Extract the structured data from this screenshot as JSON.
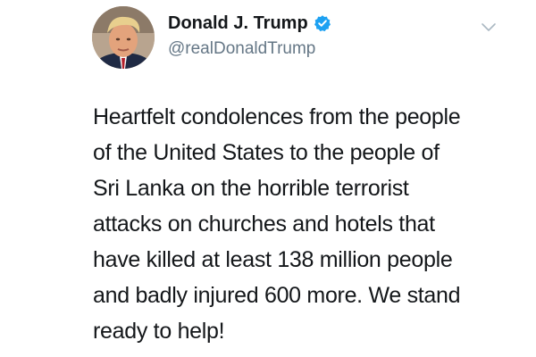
{
  "tweet": {
    "author": {
      "display_name": "Donald J. Trump",
      "handle": "@realDonaldTrump",
      "verified": true,
      "avatar_icon": "profile-photo"
    },
    "menu_icon": "chevron-down-icon",
    "text_lines": [
      "Heartfelt condolences from the people",
      "of the United States to the people of",
      "Sri Lanka on the horrible terrorist",
      "attacks on churches and hotels that",
      "have killed at least 138 million people",
      "and badly injured 600 more. We stand",
      "ready to help!"
    ]
  },
  "colors": {
    "text": "#14171a",
    "secondary_text": "#657786",
    "verified_badge": "#1da1f2",
    "chevron": "#aab8c2"
  }
}
